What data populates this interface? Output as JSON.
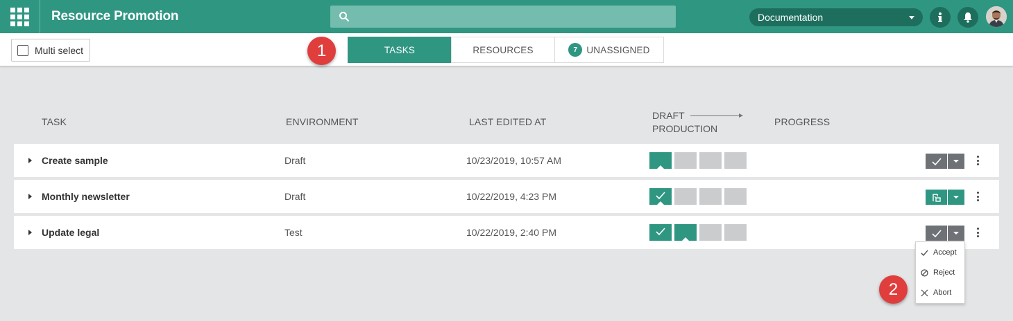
{
  "app": {
    "title": "Resource Promotion"
  },
  "search": {
    "placeholder": "",
    "value": ""
  },
  "header": {
    "project": "Documentation"
  },
  "toolbar": {
    "multi_select_label": "Multi select"
  },
  "tabs": [
    {
      "label": "TASKS",
      "active": true
    },
    {
      "label": "RESOURCES",
      "active": false
    },
    {
      "label": "UNASSIGNED",
      "active": false,
      "count": "7"
    }
  ],
  "markers": [
    "1",
    "2"
  ],
  "columns": {
    "task": "TASK",
    "environment": "ENVIRONMENT",
    "last_edited": "LAST EDITED AT",
    "draft": "DRAFT",
    "production": "PRODUCTION",
    "progress": "PROGRESS"
  },
  "rows": [
    {
      "name": "Create sample",
      "environment": "Draft",
      "edited": "10/23/2019, 10:57 AM",
      "stages": [
        "current",
        "todo",
        "todo",
        "todo"
      ],
      "action": "accept"
    },
    {
      "name": "Monthly newsletter",
      "environment": "Draft",
      "edited": "10/22/2019, 4:23 PM",
      "stages": [
        "done-current",
        "todo",
        "todo",
        "todo"
      ],
      "action": "promote"
    },
    {
      "name": "Update legal",
      "environment": "Test",
      "edited": "10/22/2019, 2:40 PM",
      "stages": [
        "done",
        "current",
        "todo",
        "todo"
      ],
      "action": "accept"
    }
  ],
  "menu": {
    "items": [
      "Accept",
      "Reject",
      "Abort"
    ]
  },
  "colors": {
    "accent": "#2f9682",
    "accent_dark": "#1e6e5e",
    "marker": "#e03d3d",
    "action_gray": "#6e7277"
  }
}
